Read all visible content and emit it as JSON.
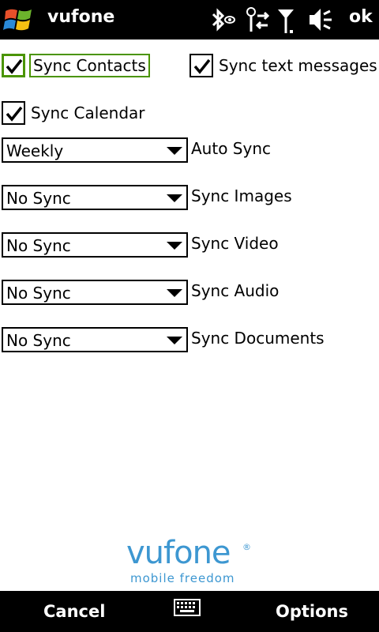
{
  "titlebar": {
    "title": "vufone",
    "ok_label": "ok",
    "status_icons": [
      "bluetooth-icon",
      "connectivity-icon",
      "signal-icon",
      "volume-muted-icon"
    ]
  },
  "checkboxes": [
    {
      "label": "Sync Contacts",
      "checked": true,
      "focused": true
    },
    {
      "label": "Sync text messages",
      "checked": true,
      "focused": false
    },
    {
      "label": "Sync Calendar",
      "checked": true,
      "focused": false
    }
  ],
  "sync_settings": [
    {
      "value": "Weekly",
      "label": "Auto Sync"
    },
    {
      "value": "No Sync",
      "label": "Sync Images"
    },
    {
      "value": "No Sync",
      "label": "Sync Video"
    },
    {
      "value": "No Sync",
      "label": "Sync Audio"
    },
    {
      "value": "No Sync",
      "label": "Sync Documents"
    }
  ],
  "logo": {
    "wordmark": "vufone",
    "registered": "®",
    "tagline": "mobile freedom",
    "color": "#3d97d1"
  },
  "softkeys": {
    "left": "Cancel",
    "right": "Options",
    "center_icon": "keyboard-icon"
  },
  "colors": {
    "focus": "#4a9400",
    "bar": "#000000"
  }
}
